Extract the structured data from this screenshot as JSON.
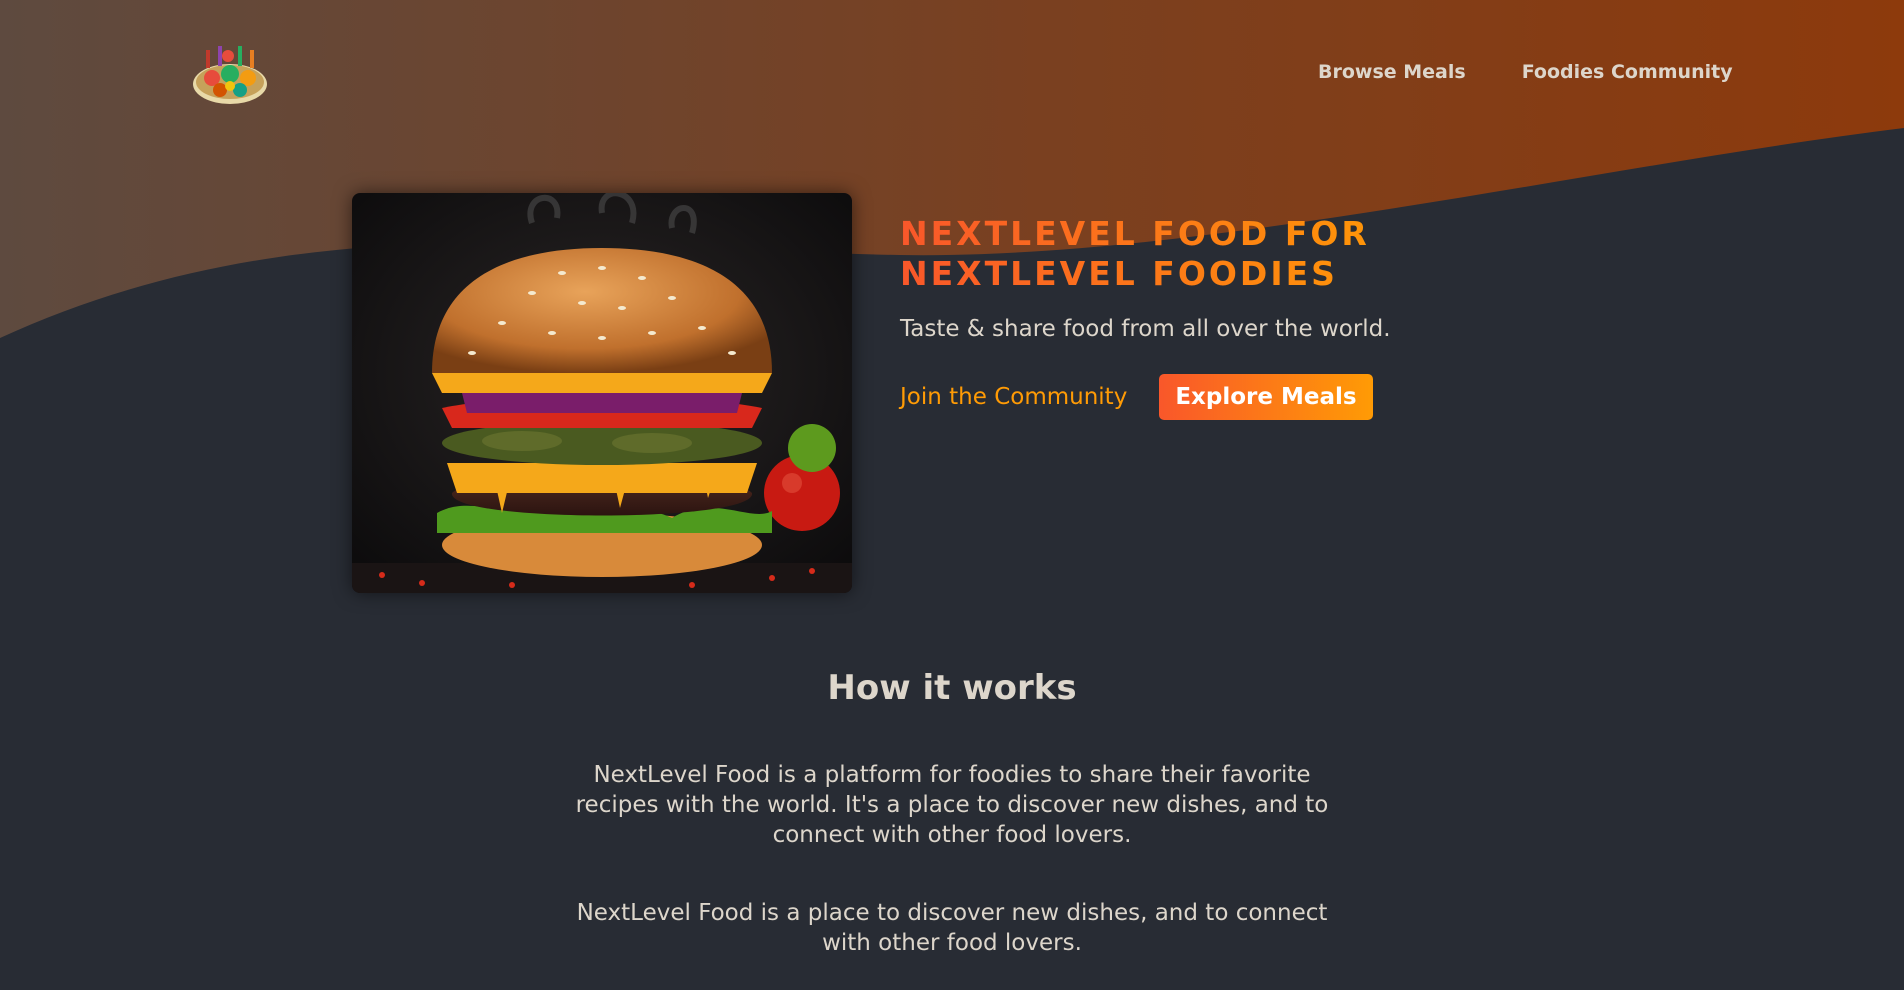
{
  "header": {
    "logo_icon": "food-platter-logo",
    "nav": [
      {
        "label": "Browse Meals"
      },
      {
        "label": "Foodies Community"
      }
    ]
  },
  "hero": {
    "image_icon": "burger-photo",
    "title": "NEXTLEVEL FOOD FOR NEXTLEVEL FOODIES",
    "subtitle": "Taste & share food from all over the world.",
    "join_link": "Join the Community",
    "explore_button": "Explore Meals"
  },
  "how_it_works": {
    "heading": "How it works",
    "paragraph_1": "NextLevel Food is a platform for foodies to share their favorite recipes with the world. It's a place to discover new dishes, and to connect with other food lovers.",
    "paragraph_2": "NextLevel Food is a place to discover new dishes, and to connect with other food lovers."
  },
  "colors": {
    "background": "#282c34",
    "accent_start": "#f9572a",
    "accent_end": "#ff9b05",
    "header_wave_start": "#5e4538",
    "header_wave_end": "#8a3b0e",
    "text": "#ddd6cb"
  }
}
